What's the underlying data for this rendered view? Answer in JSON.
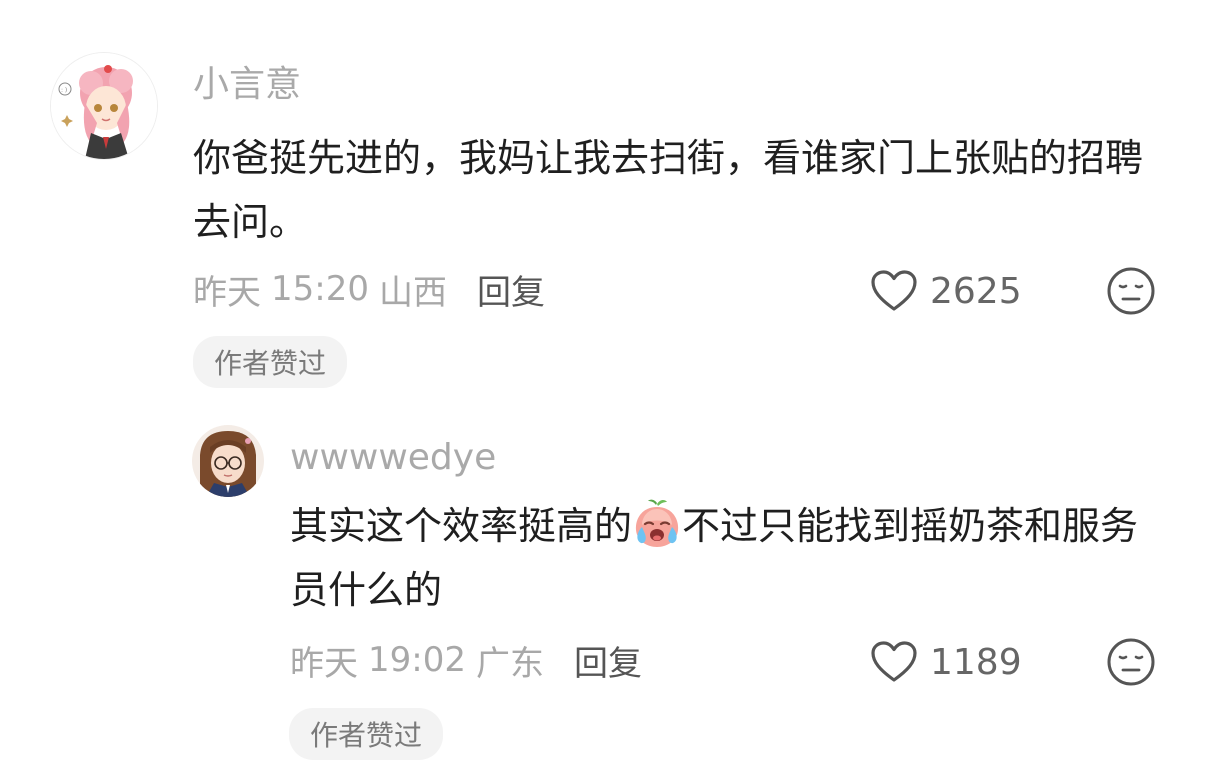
{
  "comments": [
    {
      "username": "小言意",
      "text": "你爸挺先进的，我妈让我去扫街，看谁家门上张贴的招聘去问。",
      "date": "昨天",
      "time": "15:20",
      "location": "山西",
      "reply_label": "回复",
      "likes": "2625",
      "badge": "作者赞过",
      "avatar_icon": "anime-girl-pink-hair-avatar"
    },
    {
      "username": "wwwwedye",
      "text_before": "其实这个效率挺高的",
      "text_after": "不过只能找到摇奶茶和服务员什么的",
      "inline_emoji": "crying-peach-emoji",
      "date": "昨天",
      "time": "19:02",
      "location": "广东",
      "reply_label": "回复",
      "likes": "1189",
      "badge": "作者赞过",
      "avatar_icon": "anime-girl-glasses-avatar"
    }
  ],
  "icons": {
    "like": "heart-outline-icon",
    "dislike": "meh-face-icon"
  },
  "colors": {
    "muted_text": "#a8a8a8",
    "body_text": "#1f1f1f",
    "badge_bg": "#f3f3f3"
  }
}
